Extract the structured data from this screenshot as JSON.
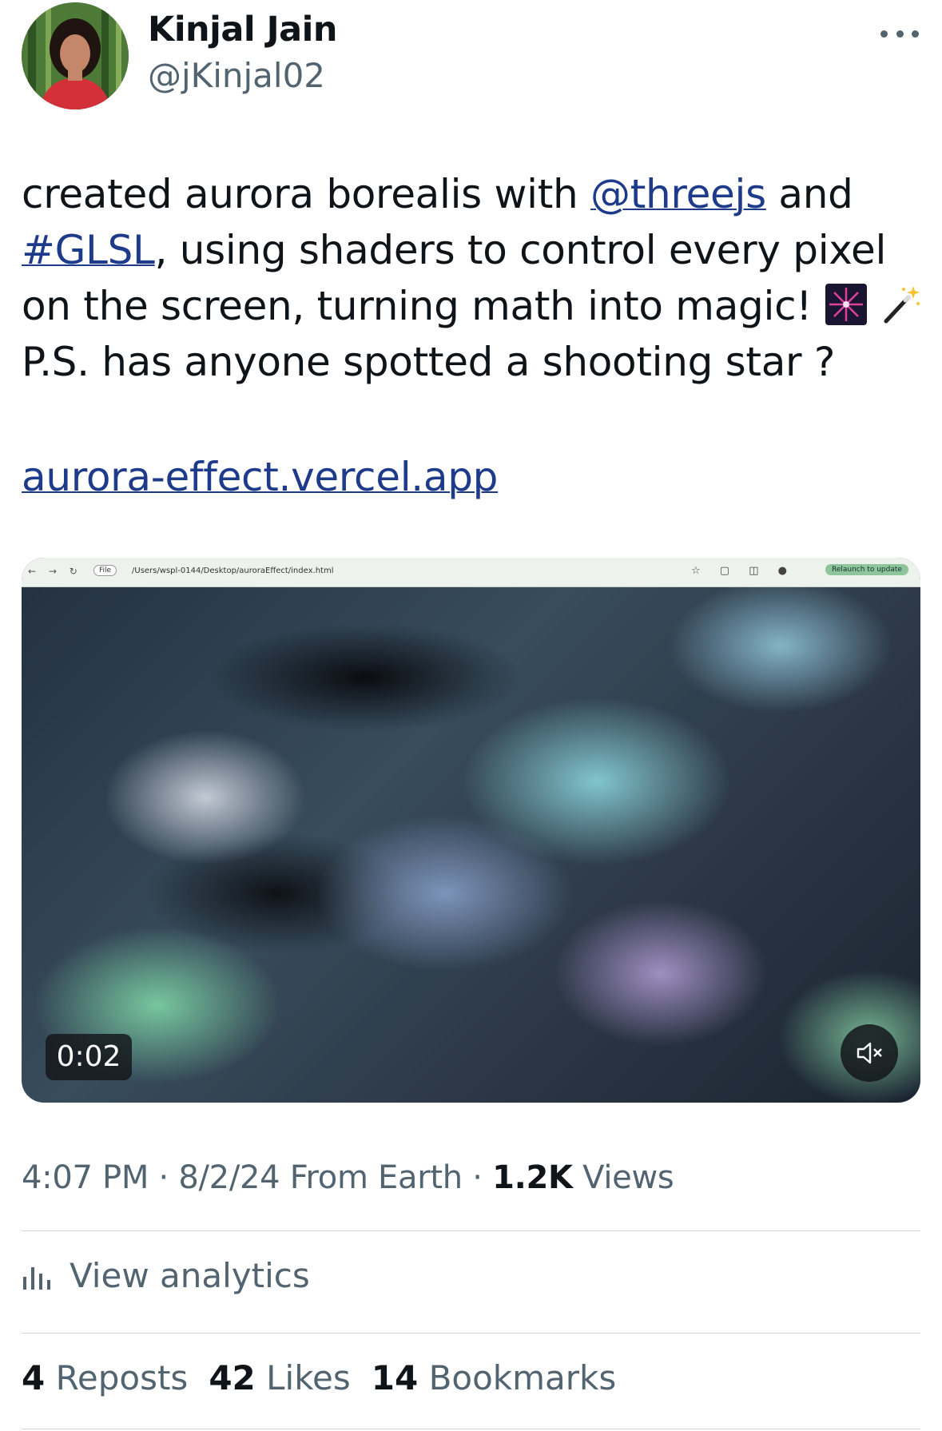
{
  "author": {
    "name": "Kinjal Jain",
    "handle": "@jKinjal02"
  },
  "tweet": {
    "text_part1": "created aurora borealis with ",
    "mention": "@threejs",
    "text_part2": " and",
    "hashtag": "#GLSL",
    "text_part3": ", using shaders to control every pixel on the screen, turning math into magic!",
    "emojis": [
      "fireworks-emoji",
      "magic-wand-emoji"
    ],
    "text_part4": "P.S. has anyone spotted a shooting star ?",
    "link": "aurora-effect.vercel.app"
  },
  "video": {
    "browser_file_label": "File",
    "browser_url": "/Users/wspl-0144/Desktop/auroraEffect/index.html",
    "browser_relaunch": "Relaunch to update",
    "timer": "0:02",
    "muted_icon": "volume-muted-icon"
  },
  "meta": {
    "time": "4:07 PM",
    "sep1": "·",
    "date": "8/2/24",
    "source": "From Earth",
    "sep2": "·",
    "views_count": "1.2K",
    "views_label": "Views"
  },
  "analytics": {
    "label": "View analytics"
  },
  "stats": {
    "reposts_count": "4",
    "reposts_label": "Reposts",
    "likes_count": "42",
    "likes_label": "Likes",
    "bookmarks_count": "14",
    "bookmarks_label": "Bookmarks"
  },
  "colors": {
    "link": "#1d3b8a",
    "muted_text": "#536471",
    "primary_text": "#0f1419",
    "divider": "#cfd9de"
  }
}
